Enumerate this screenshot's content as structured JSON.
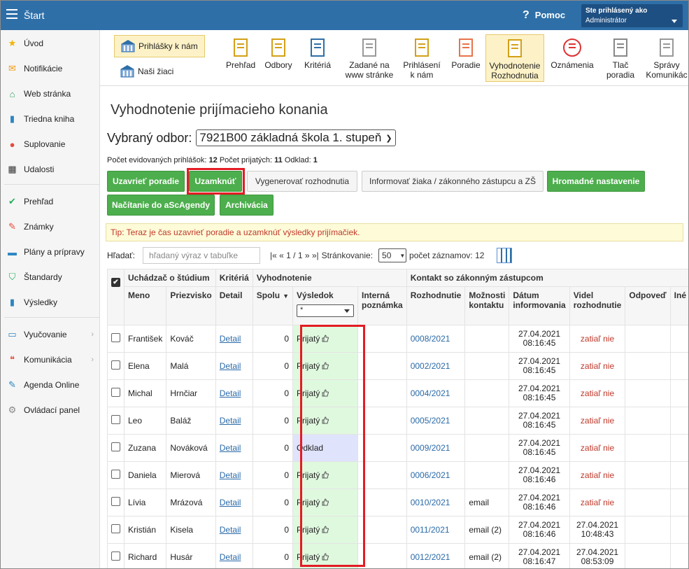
{
  "topbar": {
    "title": "Štart",
    "help_label": "Pomoc",
    "user_line1": "Ste prihlásený ako",
    "user_line2": "Administrátor"
  },
  "sidebar": {
    "items": [
      {
        "label": "Úvod",
        "icon": "star-icon",
        "color": "#f0b400"
      },
      {
        "label": "Notifikácie",
        "icon": "envelope-icon",
        "color": "#f39c12"
      },
      {
        "label": "Web stránka",
        "icon": "home-icon",
        "color": "#2e9e5b"
      },
      {
        "label": "Triedna kniha",
        "icon": "book-icon",
        "color": "#2e86c1"
      },
      {
        "label": "Suplovanie",
        "icon": "person-icon",
        "color": "#e74c3c"
      },
      {
        "label": "Udalosti",
        "icon": "calendar-icon",
        "color": "#333333"
      },
      {
        "label": "Prehľad",
        "icon": "check-circle-icon",
        "color": "#27ae60"
      },
      {
        "label": "Známky",
        "icon": "grade-icon",
        "color": "#e74c3c"
      },
      {
        "label": "Plány a prípravy",
        "icon": "briefcase-icon",
        "color": "#2e86c1"
      },
      {
        "label": "Štandardy",
        "icon": "shield-icon",
        "color": "#27ae60"
      },
      {
        "label": "Výsledky",
        "icon": "bar-chart-icon",
        "color": "#2e86c1"
      },
      {
        "label": "Vyučovanie",
        "icon": "book-open-icon",
        "color": "#2e86c1"
      },
      {
        "label": "Komunikácia",
        "icon": "chat-icon",
        "color": "#e74c3c"
      },
      {
        "label": "Agenda Online",
        "icon": "pen-icon",
        "color": "#2e86c1"
      },
      {
        "label": "Ovládací panel",
        "icon": "gear-icon",
        "color": "#888888"
      }
    ]
  },
  "toolbar": {
    "sub": [
      {
        "label": "Prihlášky k nám"
      },
      {
        "label": "Naši žiaci"
      }
    ],
    "items": [
      {
        "label": "Prehľad"
      },
      {
        "label": "Odbory"
      },
      {
        "label": "Kritériá"
      },
      {
        "label": "Zadané na www stránke"
      },
      {
        "label": "Prihlásení k nám"
      },
      {
        "label": "Poradie"
      },
      {
        "label": "Vyhodnotenie Rozhodnutia"
      },
      {
        "label": "Oznámenia"
      },
      {
        "label": "Tlač poradia"
      },
      {
        "label": "Správy Komunikác"
      }
    ]
  },
  "page": {
    "title": "Vyhodnotenie prijímacieho konania",
    "odbor_label": "Vybraný odbor:",
    "odbor_value": "7921B00 základná škola 1. stupeň",
    "stats": {
      "registered_label": "Počet evidovaných prihlášok:",
      "registered": "12",
      "accepted_label": "Počet prijatých:",
      "accepted": "11",
      "deferred_label": "Odklad:",
      "deferred": "1"
    },
    "buttons": {
      "close_ranking": "Uzavrieť poradie",
      "lock": "Uzamknúť",
      "generate": "Vygenerovať rozhodnutia",
      "inform": "Informovať žiaka / zákonného zástupcu a ZŠ",
      "bulk": "Hromadné nastavenie",
      "load": "Načítanie do aScAgendy",
      "archive": "Archivácia"
    },
    "tip": "Tip: Teraz je čas uzavrieť poradie a uzamknúť výsledky prijímačiek.",
    "search": {
      "label": "Hľadať:",
      "placeholder": "hľadaný výraz v tabuľke"
    },
    "pager": {
      "nav": "|« « 1 / 1 » »|",
      "per_page_label": "Stránkovanie:",
      "per_page": "50",
      "count_label": "počet záznamov: 12"
    }
  },
  "table": {
    "groups": {
      "applicant": "Uchádzač o štúdium",
      "criteria": "Kritériá",
      "evaluation": "Vyhodnotenie",
      "contact": "Kontakt so zákonným zástupcom"
    },
    "columns": {
      "first": "Meno",
      "last": "Priezvisko",
      "detail": "Detail",
      "total": "Spolu",
      "result": "Výsledok",
      "note": "Interná poznámka",
      "decision": "Rozhodnutie",
      "contact_opts": "Možnosti kontaktu",
      "info_date": "Dátum informovania",
      "seen": "Videl rozhodnutie",
      "reply": "Odpoveď",
      "extra": "Iné"
    },
    "filter_value": "*",
    "rows": [
      {
        "first": "František",
        "last": "Kováč",
        "detail": "Detail",
        "total": "0",
        "result": "Prijatý",
        "status": "accepted",
        "decision": "0008/2021",
        "contact": "",
        "date": "27.04.2021",
        "time": "08:16:45",
        "seen": "zatiaľ nie",
        "seen2": ""
      },
      {
        "first": "Elena",
        "last": "Malá",
        "detail": "Detail",
        "total": "0",
        "result": "Prijatý",
        "status": "accepted",
        "decision": "0002/2021",
        "contact": "",
        "date": "27.04.2021",
        "time": "08:16:45",
        "seen": "zatiaľ nie",
        "seen2": ""
      },
      {
        "first": "Michal",
        "last": "Hrnčiar",
        "detail": "Detail",
        "total": "0",
        "result": "Prijatý",
        "status": "accepted",
        "decision": "0004/2021",
        "contact": "",
        "date": "27.04.2021",
        "time": "08:16:45",
        "seen": "zatiaľ nie",
        "seen2": ""
      },
      {
        "first": "Leo",
        "last": "Baláž",
        "detail": "Detail",
        "total": "0",
        "result": "Prijatý",
        "status": "accepted",
        "decision": "0005/2021",
        "contact": "",
        "date": "27.04.2021",
        "time": "08:16:45",
        "seen": "zatiaľ nie",
        "seen2": ""
      },
      {
        "first": "Zuzana",
        "last": "Nováková",
        "detail": "Detail",
        "total": "0",
        "result": "Odklad",
        "status": "deferred",
        "decision": "0009/2021",
        "contact": "",
        "date": "27.04.2021",
        "time": "08:16:45",
        "seen": "zatiaľ nie",
        "seen2": ""
      },
      {
        "first": "Daniela",
        "last": "Mierová",
        "detail": "Detail",
        "total": "0",
        "result": "Prijatý",
        "status": "accepted",
        "decision": "0006/2021",
        "contact": "",
        "date": "27.04.2021",
        "time": "08:16:46",
        "seen": "zatiaľ nie",
        "seen2": ""
      },
      {
        "first": "Lívia",
        "last": "Mrázová",
        "detail": "Detail",
        "total": "0",
        "result": "Prijatý",
        "status": "accepted",
        "decision": "0010/2021",
        "contact": "email",
        "date": "27.04.2021",
        "time": "08:16:46",
        "seen": "zatiaľ nie",
        "seen2": ""
      },
      {
        "first": "Kristián",
        "last": "Kisela",
        "detail": "Detail",
        "total": "0",
        "result": "Prijatý",
        "status": "accepted",
        "decision": "0011/2021",
        "contact": "email (2)",
        "date": "27.04.2021",
        "time": "08:16:46",
        "seen": "27.04.2021",
        "seen2": "10:48:43"
      },
      {
        "first": "Richard",
        "last": "Husár",
        "detail": "Detail",
        "total": "0",
        "result": "Prijatý",
        "status": "accepted",
        "decision": "0012/2021",
        "contact": "email (2)",
        "date": "27.04.2021",
        "time": "08:16:47",
        "seen": "27.04.2021",
        "seen2": "08:53:09"
      }
    ]
  }
}
